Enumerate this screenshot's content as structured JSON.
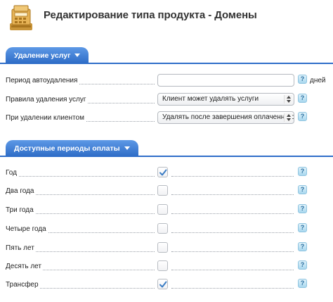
{
  "header": {
    "title": "Редактирование типа продукта - Домены",
    "logo_icon": "cash-register-icon"
  },
  "sections": [
    {
      "tab_label": "Удаление услуг",
      "rows": [
        {
          "label": "Период автоудаления",
          "value": "",
          "suffix": "дней"
        },
        {
          "label": "Правила удаления услуг",
          "value": "Клиент может удалять услуги"
        },
        {
          "label": "При удалении клиентом",
          "value": "Удалять после завершения оплаченного"
        }
      ]
    },
    {
      "tab_label": "Доступные периоды оплаты",
      "rows": [
        {
          "label": "Год",
          "checked": true
        },
        {
          "label": "Два года",
          "checked": false
        },
        {
          "label": "Три года",
          "checked": false
        },
        {
          "label": "Четыре года",
          "checked": false
        },
        {
          "label": "Пять лет",
          "checked": false
        },
        {
          "label": "Десять лет",
          "checked": false
        },
        {
          "label": "Трансфер",
          "checked": true
        }
      ]
    }
  ],
  "help_glyph": "?",
  "colors": {
    "accent": "#2f6ec9",
    "tab_top": "#5d99e6",
    "tab_bottom": "#2d6bc6",
    "help_bg": "#a9d7ee",
    "check": "#3c7dc4"
  }
}
